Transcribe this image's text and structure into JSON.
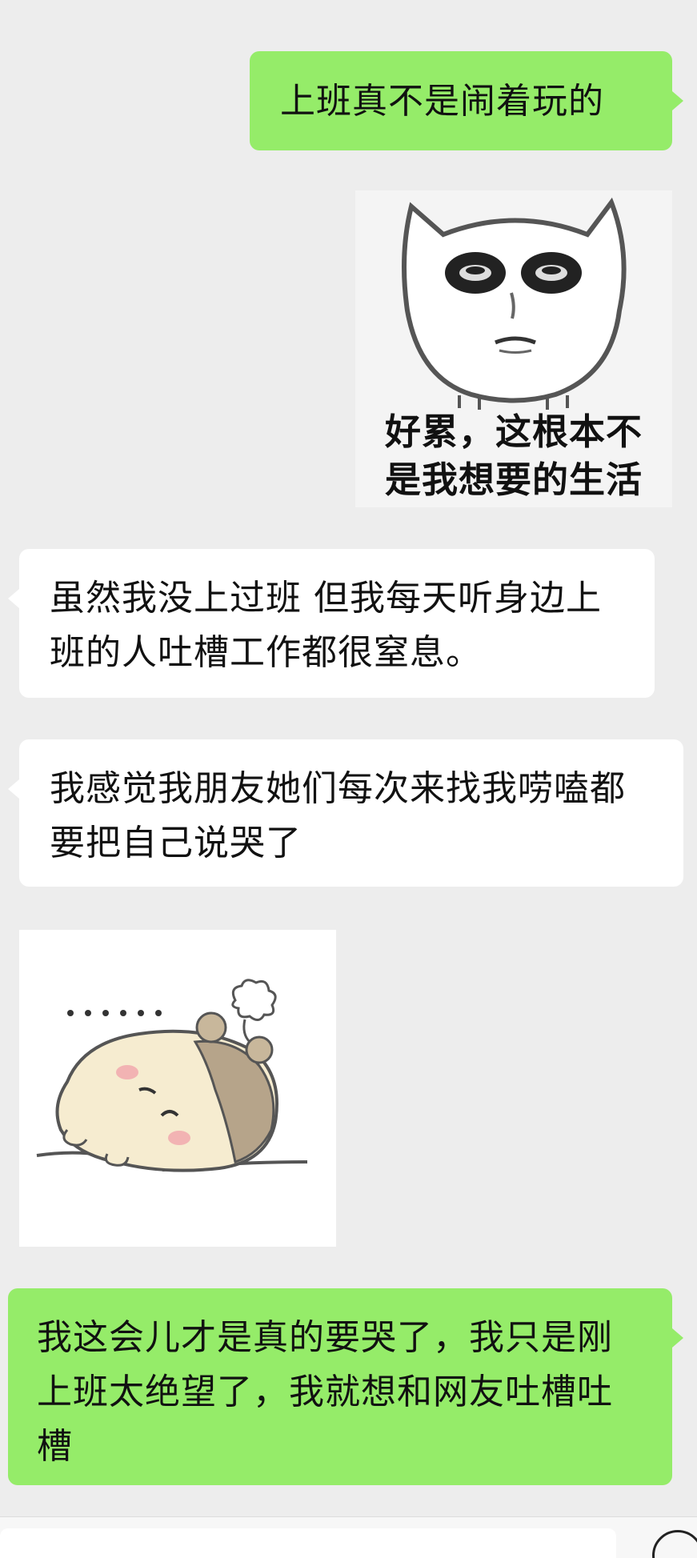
{
  "messages": [
    {
      "side": "right",
      "type": "text",
      "text": "上班真不是闹着玩的"
    },
    {
      "side": "right",
      "type": "sticker",
      "icon": "tired-cat-face-sticker",
      "caption_line1": "好累，这根本不",
      "caption_line2": "是我想要的生活"
    },
    {
      "side": "left",
      "type": "text",
      "text": "虽然我没上过班 但我每天听身边上班的人吐槽工作都很窒息。"
    },
    {
      "side": "left",
      "type": "text",
      "text": "我感觉我朋友她们每次来找我唠嗑都要把自己说哭了"
    },
    {
      "side": "left",
      "type": "sticker",
      "icon": "lying-hamster-sticker",
      "dots": "······"
    },
    {
      "side": "right",
      "type": "text",
      "text": "我这会儿才是真的要哭了，我只是刚上班太绝望了，我就想和网友吐槽吐槽"
    }
  ],
  "colors": {
    "background": "#ededed",
    "self_bubble": "#95ec69",
    "other_bubble": "#ffffff"
  }
}
